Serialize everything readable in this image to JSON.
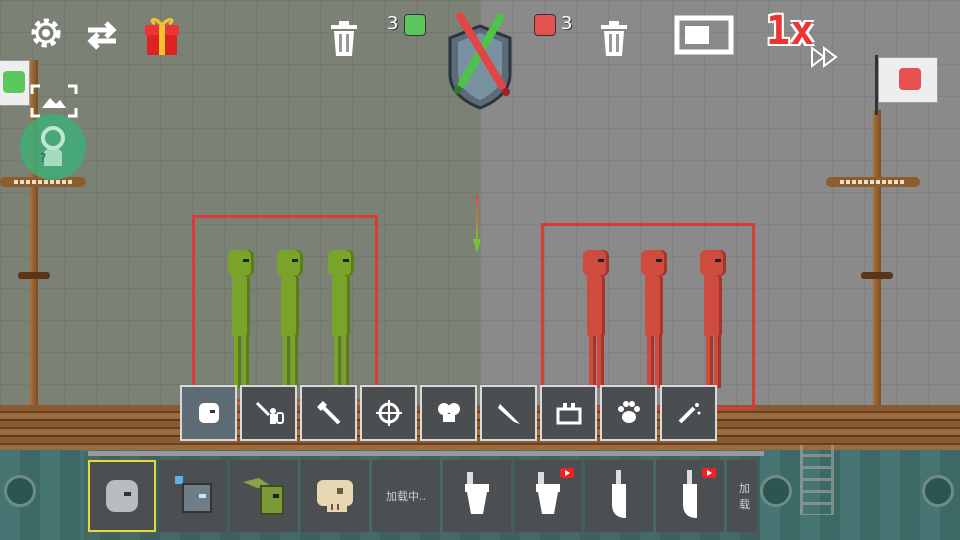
{
  "hud": {
    "green_team_count": "3",
    "red_team_count": "3",
    "speed_label": "1x"
  },
  "colors": {
    "green_team": "#7aa32a",
    "red_team": "#cf4b3e",
    "selection_box": "#d93a3a",
    "selected_item_border": "#e5dd33"
  },
  "categories": [
    {
      "icon": "melon-head-icon",
      "active": true
    },
    {
      "icon": "melee-weapons-icon"
    },
    {
      "icon": "tools-icon"
    },
    {
      "icon": "crosshair-icon"
    },
    {
      "icon": "explosives-icon"
    },
    {
      "icon": "missile-icon"
    },
    {
      "icon": "machines-icon"
    },
    {
      "icon": "animals-paw-icon"
    },
    {
      "icon": "magic-wand-icon"
    }
  ],
  "items": [
    {
      "icon": "gray-blob-icon",
      "selected": true
    },
    {
      "icon": "robot-head-icon"
    },
    {
      "icon": "zombie-icon"
    },
    {
      "icon": "skull-icon"
    },
    {
      "label": "加载中.."
    },
    {
      "icon": "toilet-icon"
    },
    {
      "icon": "toilet-icon",
      "video_ad": true
    },
    {
      "icon": "urinal-icon"
    },
    {
      "icon": "urinal-icon",
      "video_ad": true
    },
    {
      "label": "加载"
    }
  ]
}
